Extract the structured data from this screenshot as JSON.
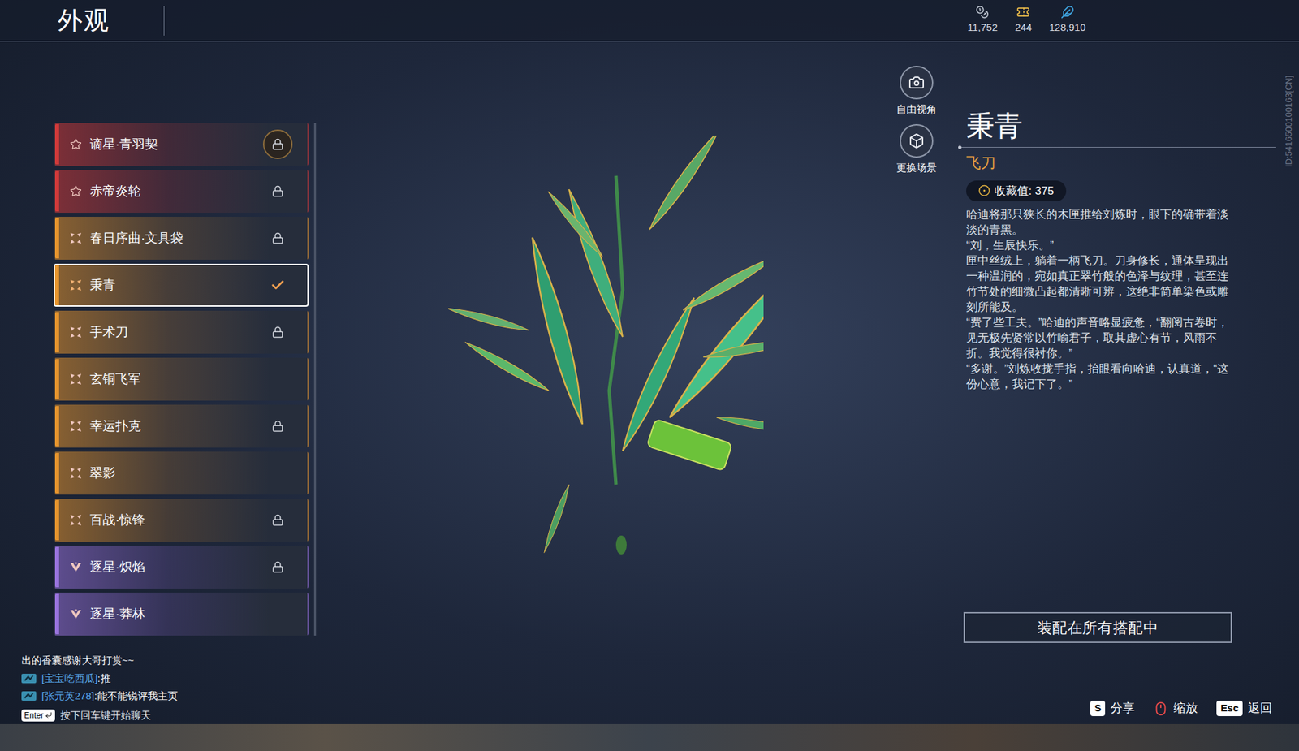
{
  "header": {
    "title": "外观",
    "currencies": [
      {
        "amount": "11,752",
        "color": "#b9c0cc"
      },
      {
        "amount": "244",
        "color": "#e6b84a"
      },
      {
        "amount": "128,910",
        "color": "#3fa4e0"
      }
    ]
  },
  "account_id": "ID:5416500100163[CN]",
  "appearance_list": [
    {
      "name": "谪星·青羽契",
      "kind": "star",
      "color": "#d33a3a",
      "locked": true,
      "badge": true,
      "equipped": false,
      "selected": false
    },
    {
      "name": "赤帝炎轮",
      "kind": "star",
      "color": "#d33a3a",
      "locked": true,
      "badge": false,
      "equipped": false,
      "selected": false
    },
    {
      "name": "春日序曲·文具袋",
      "kind": "flower",
      "color": "#e8962e",
      "locked": true,
      "badge": false,
      "equipped": false,
      "selected": false
    },
    {
      "name": "秉青",
      "kind": "flower",
      "color": "#e8962e",
      "locked": false,
      "badge": false,
      "equipped": true,
      "selected": true
    },
    {
      "name": "手术刀",
      "kind": "flower",
      "color": "#e8962e",
      "locked": true,
      "badge": false,
      "equipped": false,
      "selected": false
    },
    {
      "name": "玄铜飞军",
      "kind": "flower",
      "color": "#e8962e",
      "locked": false,
      "badge": false,
      "equipped": false,
      "selected": false
    },
    {
      "name": "幸运扑克",
      "kind": "flower",
      "color": "#e8962e",
      "locked": true,
      "badge": false,
      "equipped": false,
      "selected": false
    },
    {
      "name": "翠影",
      "kind": "flower",
      "color": "#e8962e",
      "locked": false,
      "badge": false,
      "equipped": false,
      "selected": false
    },
    {
      "name": "百战·惊锋",
      "kind": "flower",
      "color": "#e8962e",
      "locked": true,
      "badge": false,
      "equipped": false,
      "selected": false
    },
    {
      "name": "逐星·炽焰",
      "kind": "chevron",
      "color": "#9b74e0",
      "locked": true,
      "badge": false,
      "equipped": false,
      "selected": false
    },
    {
      "name": "逐星·莽林",
      "kind": "chevron",
      "color": "#9b74e0",
      "locked": false,
      "badge": false,
      "equipped": false,
      "selected": false
    }
  ],
  "view_buttons": [
    {
      "label": "自由视角"
    },
    {
      "label": "更换场景"
    }
  ],
  "item": {
    "name": "秉青",
    "type": "飞刀",
    "collection": "收藏值: 375",
    "description": [
      "哈迪将那只狭长的木匣推给刘炼时，眼下的确带着淡淡的青黑。",
      "“刘，生辰快乐。”",
      "匣中丝绒上，躺着一柄飞刀。刀身修长，通体呈现出一种温润的，宛如真正翠竹般的色泽与纹理，甚至连竹节处的细微凸起都清晰可辨，这绝非简单染色或雕刻所能及。",
      "“费了些工夫。”哈迪的声音略显疲惫，“翻阅古卷时，见无极先贤常以竹喻君子，取其虚心有节，风雨不折。我觉得很衬你。”",
      "“多谢。”刘炼收拢手指，抬眼看向哈迪，认真道，“这份心意，我记下了。”"
    ],
    "equip_button": "装配在所有搭配中"
  },
  "chat": {
    "messages": [
      {
        "user": "",
        "text": "出的香囊感谢大哥打赏~~",
        "badge": false
      },
      {
        "user": "[宝宝吃西瓜]",
        "text": ":推",
        "badge": true
      },
      {
        "user": "[张元英278]",
        "text": ":能不能锐评我主页",
        "badge": true
      }
    ],
    "hint_key": "Enter",
    "hint": "按下回车键开始聊天"
  },
  "shortcuts": [
    {
      "kind": "key",
      "key": "S",
      "label": "分享"
    },
    {
      "kind": "mouse",
      "key": "",
      "label": "缩放"
    },
    {
      "kind": "key",
      "key": "Esc",
      "label": "返回"
    }
  ]
}
